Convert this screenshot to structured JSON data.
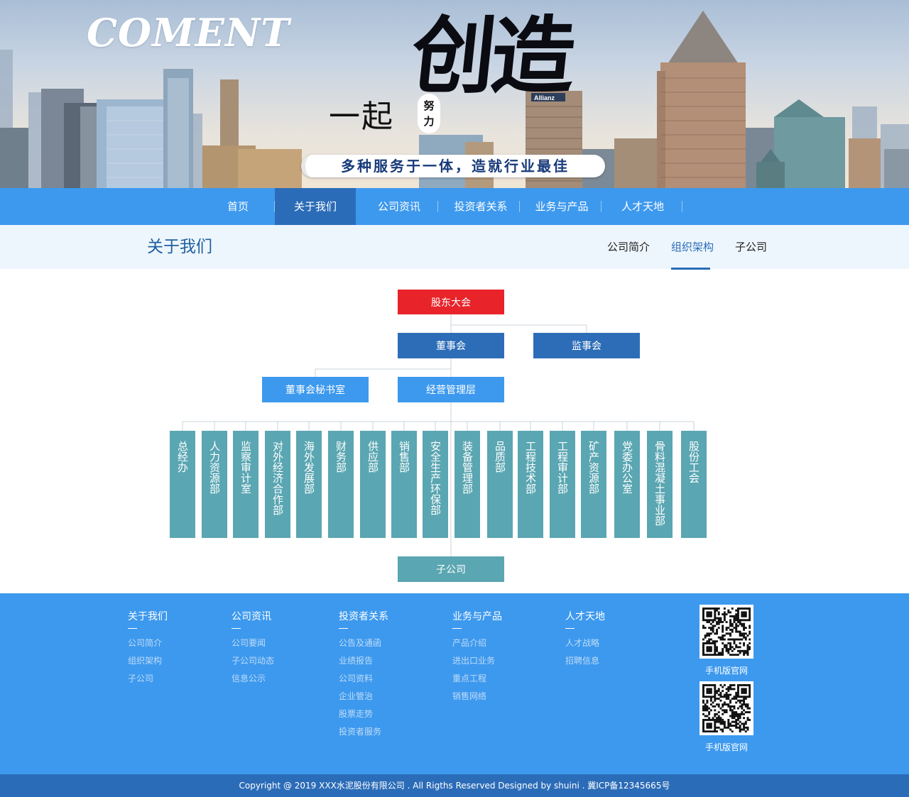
{
  "banner": {
    "brand": "COMENT",
    "slogan_prefix": "一起",
    "slogan_small": "努力",
    "slogan_main": "创造",
    "tagline": "多种服务于一体，造就行业最佳",
    "billboard": "Allianz"
  },
  "nav": {
    "items": [
      {
        "label": "首页"
      },
      {
        "label": "关于我们"
      },
      {
        "label": "公司资讯"
      },
      {
        "label": "投资者关系"
      },
      {
        "label": "业务与产品"
      },
      {
        "label": "人才天地"
      }
    ],
    "active": "关于我们"
  },
  "subheader": {
    "title": "关于我们",
    "tabs": [
      {
        "label": "公司简介"
      },
      {
        "label": "组织架构"
      },
      {
        "label": "子公司"
      }
    ],
    "active": "组织架构"
  },
  "org": {
    "top": "股东大会",
    "board": "董事会",
    "supervisory": "监事会",
    "secretary": "董事会秘书室",
    "management": "经营管理层",
    "departments": [
      "总经办",
      "人力资源部",
      "监察审计室",
      "对外经济合作部",
      "海外发展部",
      "财务部",
      "供应部",
      "销售部",
      "安全生产环保部",
      "装备管理部",
      "品质部",
      "工程技术部",
      "工程审计部",
      "矿产资源部",
      "党委办公室",
      "骨料混凝土事业部",
      "股份工会"
    ],
    "subsidiary": "子公司",
    "colors": {
      "top": "#e8232a",
      "board": "#2d6db8",
      "second": "#3d99ee",
      "dept": "#5aa6b2"
    }
  },
  "footer": {
    "columns": [
      {
        "title": "关于我们",
        "links": [
          "公司简介",
          "组织架构",
          "子公司"
        ]
      },
      {
        "title": "公司资讯",
        "links": [
          "公司要闻",
          "子公司动态",
          "信息公示"
        ]
      },
      {
        "title": "投资者关系",
        "links": [
          "公告及通函",
          "业绩报告",
          "公司资料",
          "企业管治",
          "股票走势",
          "投资者服务"
        ]
      },
      {
        "title": "业务与产品",
        "links": [
          "产品介绍",
          "进出口业务",
          "重点工程",
          "销售网络"
        ]
      },
      {
        "title": "人才天地",
        "links": [
          "人才战略",
          "招聘信息"
        ]
      }
    ],
    "qr_labels": [
      "手机版官网",
      "手机版官网"
    ],
    "copyright": "Copyright @ 2019 XXX水泥股份有限公司 . All Rigths Reserved Designed by shuini . 冀ICP备12345665号"
  }
}
